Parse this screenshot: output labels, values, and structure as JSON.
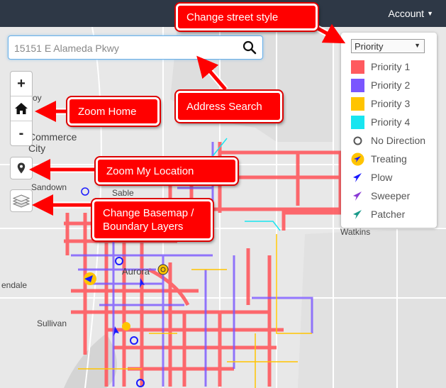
{
  "header": {
    "account_label": "Account"
  },
  "search": {
    "placeholder": "15151 E Alameda Pkwy"
  },
  "zoom": {
    "in": "+",
    "out": "-"
  },
  "legend": {
    "select_value": "Priority",
    "items": [
      {
        "label": "Priority 1",
        "color": "#ff5a5f",
        "icon": "square-swatch"
      },
      {
        "label": "Priority 2",
        "color": "#7a56ff",
        "icon": "square-swatch"
      },
      {
        "label": "Priority 3",
        "color": "#ffc400",
        "icon": "square-swatch"
      },
      {
        "label": "Priority 4",
        "color": "#19e5f0",
        "icon": "square-swatch"
      },
      {
        "label": "No Direction",
        "color": "#555555",
        "icon": "ring-icon"
      },
      {
        "label": "Treating",
        "color": "#ffc400",
        "icon": "navigation-arrow-circle-icon"
      },
      {
        "label": "Plow",
        "color": "#1a1aff",
        "icon": "navigation-arrow-icon"
      },
      {
        "label": "Sweeper",
        "color": "#8a3ad6",
        "icon": "navigation-arrow-icon"
      },
      {
        "label": "Patcher",
        "color": "#1a9a8a",
        "icon": "navigation-arrow-icon"
      }
    ]
  },
  "map_labels": [
    "Commerce City",
    "Sandown",
    "Sable",
    "Aurora",
    "Watkins",
    "endale",
    "Sullivan",
    "oy"
  ],
  "callouts": {
    "street_style": "Change street style",
    "address_search": "Address Search",
    "zoom_home": "Zoom Home",
    "zoom_location": "Zoom My Location",
    "basemap": "Change Basemap / Boundary Layers"
  }
}
